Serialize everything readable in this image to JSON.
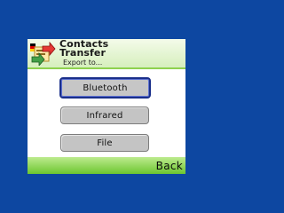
{
  "header": {
    "title_line1": "Contacts",
    "title_line2": "Transfer",
    "subtitle": "Export to..."
  },
  "menu": {
    "items": [
      {
        "label": "Bluetooth",
        "selected": true
      },
      {
        "label": "Infrared",
        "selected": false
      },
      {
        "label": "File",
        "selected": false
      }
    ]
  },
  "softkeys": {
    "right": "Back"
  },
  "colors": {
    "background": "#0d47a1",
    "accent_green": "#6cc62f",
    "selection_border": "#1a2f8a",
    "button_gray": "#c4c4c4"
  },
  "icons": {
    "logo": "contacts-transfer-logo-icon"
  }
}
